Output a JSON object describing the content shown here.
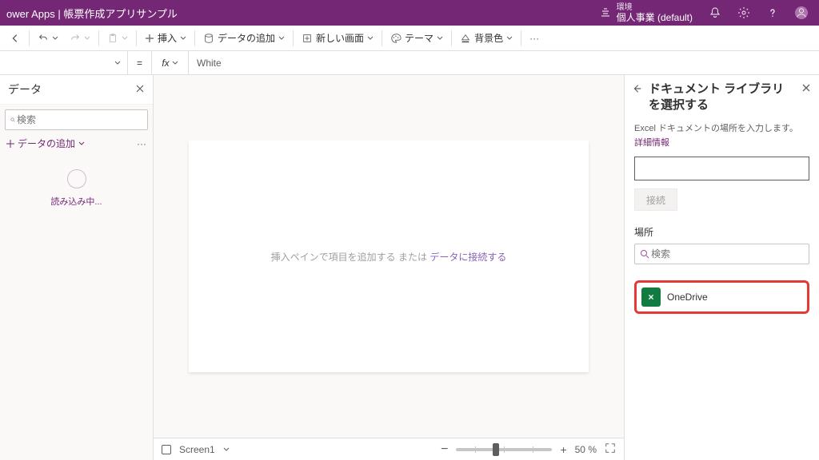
{
  "header": {
    "title_prefix": "ower Apps",
    "title_sep": " | ",
    "app_name": "帳票作成アプリサンプル",
    "env_label": "環境",
    "env_name": "個人事業 (default)"
  },
  "ribbon": {
    "insert": "挿入",
    "add_data": "データの追加",
    "new_screen": "新しい画面",
    "theme": "テーマ",
    "background": "背景色",
    "more": "···"
  },
  "formula": {
    "eq": "=",
    "fx": "fx",
    "value": "White"
  },
  "left": {
    "title": "データ",
    "search_placeholder": "検索",
    "add_data": "データの追加",
    "loading": "読み込み中..."
  },
  "canvas": {
    "placeholder_pre": "挿入ペインで項目を追加する または ",
    "placeholder_link": "データに接続する",
    "screen_name": "Screen1",
    "zoom_value": "50",
    "zoom_suffix": " %",
    "minus": "−",
    "plus": "+"
  },
  "right": {
    "title": "ドキュメント ライブラリ を選択する",
    "desc": "Excel ドキュメントの場所を入力します。",
    "more": "詳細情報",
    "connect": "接続",
    "location_label": "場所",
    "search_placeholder": "検索",
    "onedrive": "OneDrive"
  }
}
